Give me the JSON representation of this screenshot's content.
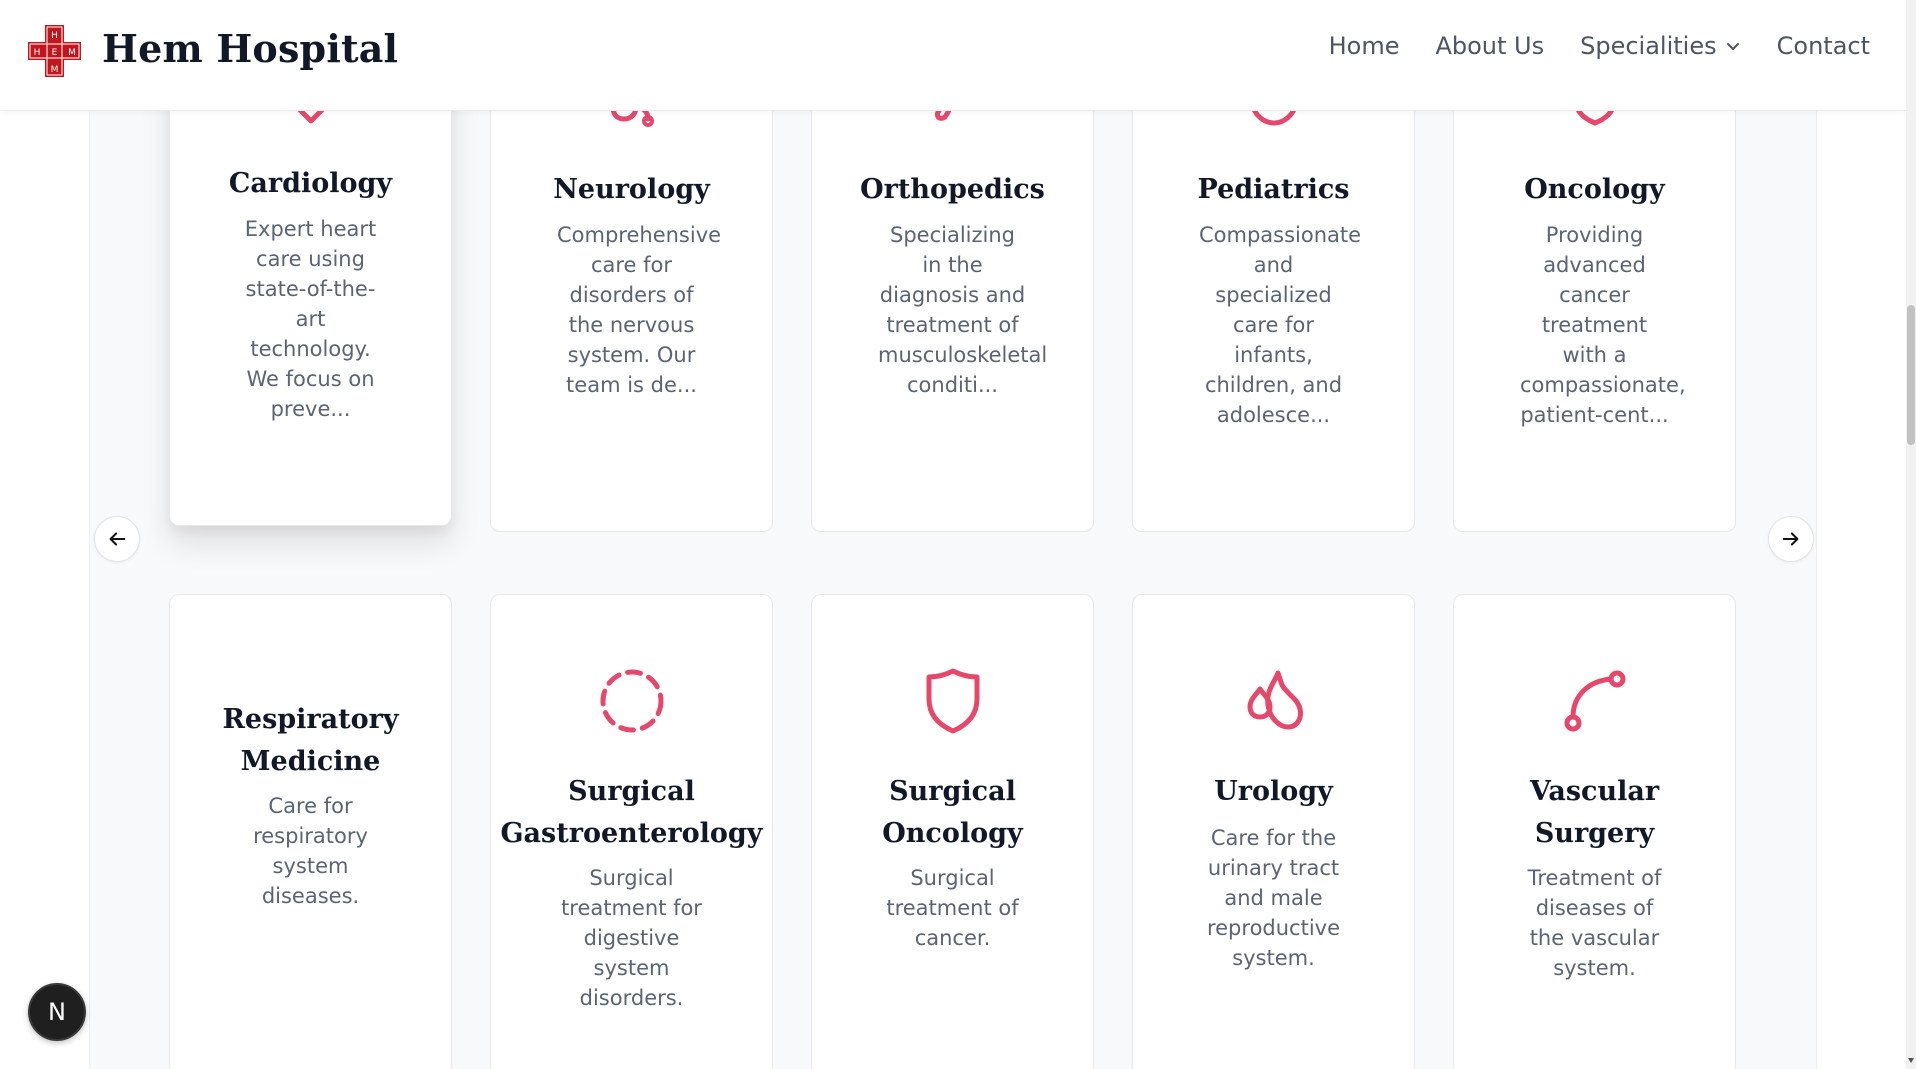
{
  "header": {
    "logo_letters": "HEM",
    "brand": "Hem Hospital",
    "nav": [
      {
        "label": "Home"
      },
      {
        "label": "About Us"
      },
      {
        "label": "Specialities",
        "icon": "chevron-down-icon"
      },
      {
        "label": "Contact"
      }
    ]
  },
  "carousel_row": [
    {
      "title": "Cardiology",
      "description": "Expert heart care using state-of-the-art technology. We focus on preve...",
      "icon": "heart-icon",
      "active": true
    },
    {
      "title": "Neurology",
      "description": "Comprehensive care for disorders of the nervous system. Our team is de...",
      "icon": "stethoscope-icon"
    },
    {
      "title": "Orthopedics",
      "description": "Specializing in the diagnosis and treatment of musculoskeletal conditi...",
      "icon": "bone-icon"
    },
    {
      "title": "Pediatrics",
      "description": "Compassionate and specialized care for infants, children, and adolesce...",
      "icon": "baby-icon"
    },
    {
      "title": "Oncology",
      "description": "Providing advanced cancer treatment with a compassionate, patient-cent...",
      "icon": "shield-icon"
    }
  ],
  "grid_row": [
    {
      "title": "Respiratory Medicine",
      "description": "Care for respiratory system diseases.",
      "icon": "none"
    },
    {
      "title": "Surgical Gastroenterology",
      "description": "Surgical treatment for digestive system disorders.",
      "icon": "dashed-circle-icon"
    },
    {
      "title": "Surgical Oncology",
      "description": "Surgical treatment of cancer.",
      "icon": "shield-icon"
    },
    {
      "title": "Urology",
      "description": "Care for the urinary tract and male reproductive system.",
      "icon": "droplets-icon"
    },
    {
      "title": "Vascular Surgery",
      "description": "Treatment of diseases of the vascular system.",
      "icon": "route-icon"
    }
  ],
  "controls": {
    "prev_icon": "arrow-left-icon",
    "next_icon": "arrow-right-icon"
  },
  "badge": {
    "letter": "N"
  },
  "colors": {
    "accent": "#e5486b",
    "brand_red": "#c0161e",
    "heading": "#111827",
    "body_text": "#5b6474",
    "nav_text": "#4b5563"
  }
}
